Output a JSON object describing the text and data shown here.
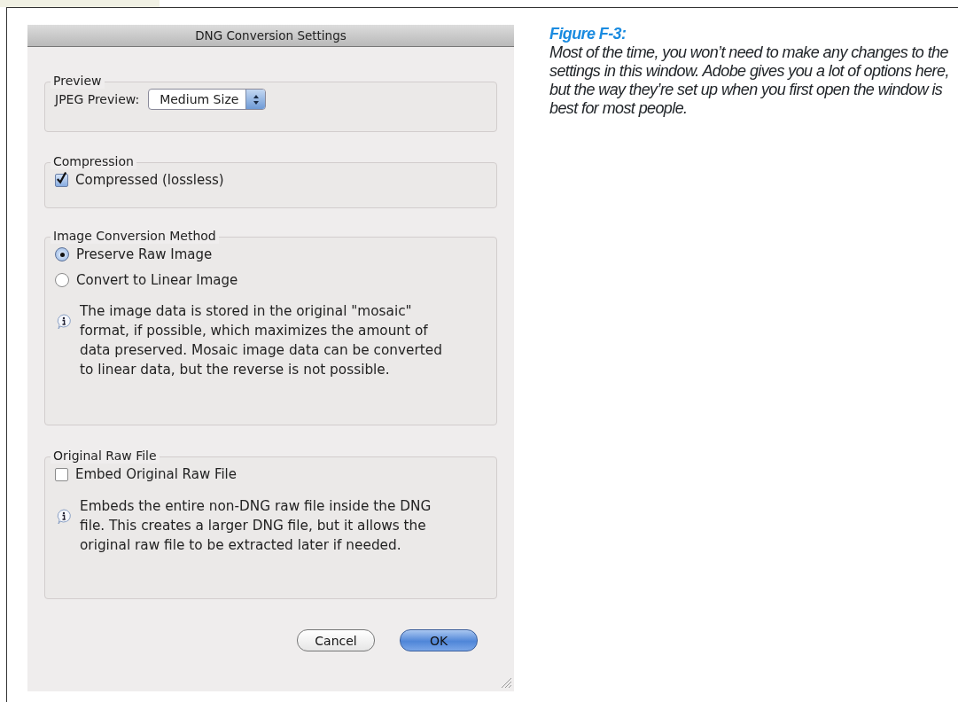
{
  "dialog": {
    "title": "DNG Conversion Settings",
    "groups": [
      {
        "title": "Preview",
        "items": [
          {
            "kind": "select",
            "label": "JPEG Preview:",
            "value": "Medium Size"
          }
        ]
      },
      {
        "title": "Compression",
        "items": [
          {
            "kind": "checkbox",
            "label": "Compressed (lossless)",
            "checked": true
          }
        ]
      },
      {
        "title": "Image Conversion Method",
        "items": [
          {
            "kind": "radio",
            "label": "Preserve Raw Image",
            "selected": true
          },
          {
            "kind": "radio",
            "label": "Convert to Linear Image",
            "selected": false
          },
          {
            "kind": "info",
            "text": "The image data is stored in the original \"mosaic\" format, if possible, which maximizes the amount of data preserved. Mosaic image data can be converted to linear data, but the reverse is not possible."
          }
        ]
      },
      {
        "title": "Original Raw File",
        "items": [
          {
            "kind": "checkbox",
            "label": "Embed Original Raw File",
            "checked": false
          },
          {
            "kind": "info",
            "text": "Embeds the entire non-DNG raw file inside the DNG file. This creates a larger DNG file, but it allows the original raw file to be extracted later if needed."
          }
        ]
      }
    ],
    "buttons": [
      {
        "label": "Cancel",
        "default": false
      },
      {
        "label": "OK",
        "default": true
      }
    ]
  },
  "caption": {
    "title": "Figure F-3:",
    "text": "Most of the time, you won’t need to make any changes to the settings in this window. Adobe gives you a lot of options here, but the way they’re set up when you first open the window is best for most people."
  }
}
